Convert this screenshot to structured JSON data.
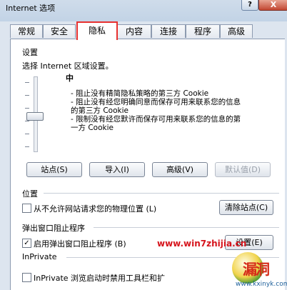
{
  "window": {
    "title": "Internet 选项",
    "help_label": "?",
    "close_label": "X"
  },
  "tabs": [
    {
      "label": "常规"
    },
    {
      "label": "安全"
    },
    {
      "label": "隐私"
    },
    {
      "label": "内容"
    },
    {
      "label": "连接"
    },
    {
      "label": "程序"
    },
    {
      "label": "高级"
    }
  ],
  "settings": {
    "heading": "设置",
    "instruction": "选择 Internet 区域设置。",
    "level": "中",
    "descriptions": [
      "- 阻止没有精简隐私策略的第三方 Cookie",
      "- 阻止没有经您明确同意而保存可用来联系您的信息",
      "的第三方 Cookie",
      "- 限制没有经您默许而保存可用来联系您的信息的第",
      "一方 Cookie"
    ],
    "slider_position": "中",
    "buttons": {
      "sites": "站点(S)",
      "import": "导入(I)",
      "advanced": "高级(V)",
      "default": "默认值(D)"
    }
  },
  "location": {
    "heading": "位置",
    "checkbox_label": "从不允许网站请求您的物理位置 (L)",
    "checked": false,
    "clear_sites": "清除站点(C)"
  },
  "popup": {
    "heading": "弹出窗口阻止程序",
    "checkbox_label": "启用弹出窗口阻止程序 (B)",
    "checked": true,
    "settings_button": "设置(E)"
  },
  "inprivate": {
    "heading": "InPrivate",
    "checkbox_label": "InPrivate 浏览启动时禁用工具栏和扩",
    "checked": false
  },
  "watermark": {
    "url": "www.win7zhijia.cn",
    "logo_text": "漏洞",
    "sub": "www.kxinyk.com"
  }
}
